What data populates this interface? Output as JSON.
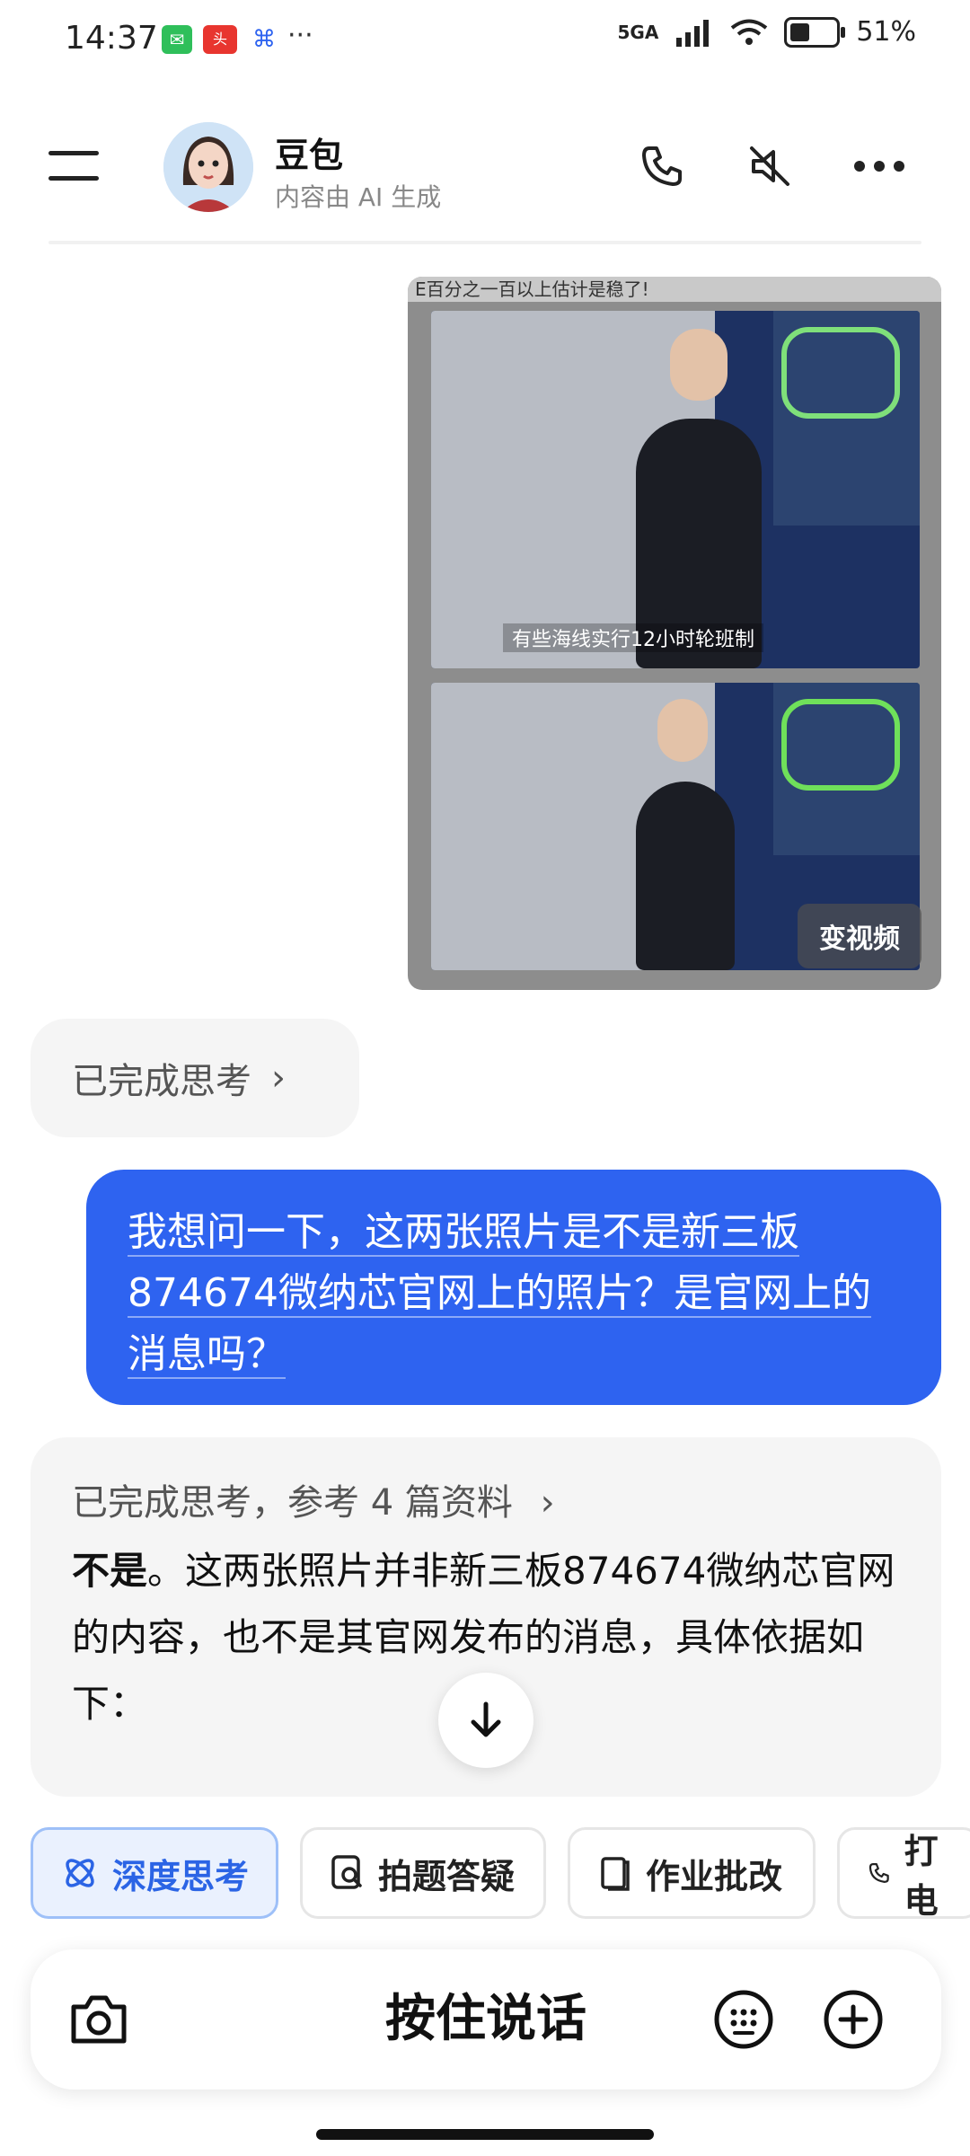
{
  "status_bar": {
    "time": "14:37",
    "network": "5GA",
    "battery": "51%",
    "battery_level": 0.51,
    "more": "···"
  },
  "header": {
    "name": "豆包",
    "subtitle": "内容由 AI 生成"
  },
  "photo": {
    "top_caption": "E百分之一百以上估计是稳了!",
    "subtitle_upper": "有些海线实行12小时轮班制",
    "video_button": "变视频"
  },
  "thinking_pill": {
    "label": "已完成思考"
  },
  "user_message": {
    "line1": "我想问一下，这两张照片是不是新三板",
    "line2": "874674微纳芯官网上的照片？是官网上的",
    "line3": "消息吗？"
  },
  "answer": {
    "head": "已完成思考，参考 4 篇资料",
    "bold": "不是",
    "text_rest": "。这两张照片并非新三板874674微纳芯官网的内容，也不是其官网发布的消息，具体依据如下："
  },
  "chips": [
    {
      "label": "深度思考",
      "icon": "atom-icon"
    },
    {
      "label": "拍题答疑",
      "icon": "photo-search-icon"
    },
    {
      "label": "作业批改",
      "icon": "homework-icon"
    },
    {
      "label": "打电",
      "icon": "phone-icon"
    }
  ],
  "input": {
    "talk_label": "按住说话"
  },
  "colors": {
    "accent": "#2e63f0",
    "chip_active_bg": "#eaf1fe",
    "card_bg": "#f5f5f5"
  }
}
